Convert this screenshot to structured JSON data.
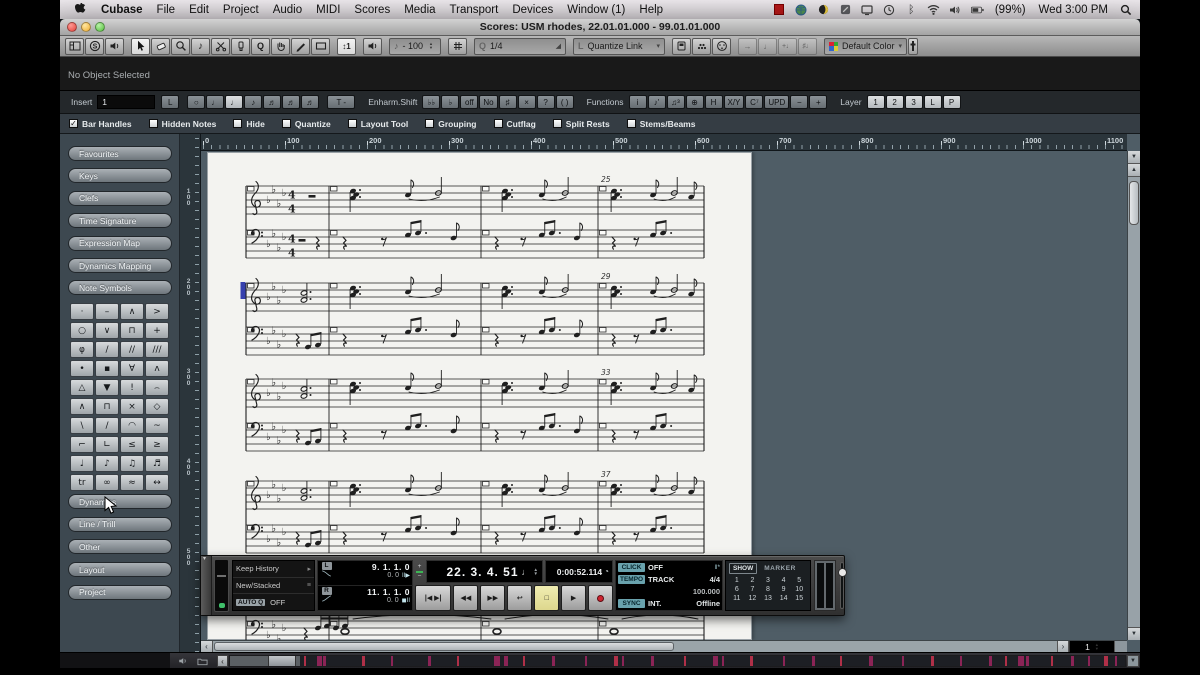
{
  "menubar": {
    "items": [
      "Cubase",
      "File",
      "Edit",
      "Project",
      "Audio",
      "MIDI",
      "Scores",
      "Media",
      "Transport",
      "Devices",
      "Window (1)",
      "Help"
    ],
    "status_icons": [
      "screen-recorder",
      "globe",
      "moon",
      "notes-app",
      "display",
      "time-machine",
      "bluetooth",
      "wifi",
      "volume",
      "battery"
    ],
    "battery": "(99%)",
    "clock": "Wed 3:00 PM"
  },
  "window": {
    "title": "Scores: USM rhodes, 22.01.01.000 - 99.01.01.000"
  },
  "toolbar": {
    "left_icons": [
      "window-layout",
      "solo",
      "acoustic-feedback"
    ],
    "tools": [
      "select",
      "erase",
      "zoom",
      "insert-note",
      "split",
      "glue",
      "quantize",
      "hand",
      "draw",
      "layout"
    ],
    "autoscroll_value": "1",
    "velocity_prefix": "-",
    "velocity_value": "100",
    "quantize_prefix": "Q",
    "quantize_value": "1/4",
    "link_prefix": "L",
    "quantize_link": "Quantize Link",
    "mini_icons": [
      "snap",
      "step-input",
      "midi-input"
    ],
    "disabled_icons": [
      "move-to-cursor",
      "note-length",
      "note-plus",
      "note-up"
    ],
    "color_label": "Default Color"
  },
  "infoline": {
    "text": "No Object Selected"
  },
  "extended": {
    "insert_label": "Insert",
    "insert_value": "1",
    "l_button": "L",
    "note_values": [
      "○",
      "♩",
      "♩",
      "♪",
      "♬",
      "♬",
      "♬"
    ],
    "note_selected_index": 2,
    "tuplet": "T",
    "tuplet_value": "-",
    "enharm_label": "Enharm.Shift",
    "enharm_buttons": [
      "♭♭",
      "♭",
      "off",
      "No",
      "♯",
      "×",
      "?",
      "( )"
    ],
    "functions_label": "Functions",
    "function_buttons": [
      "i",
      "♪'",
      "♫³",
      "⊕",
      "H",
      "X/Y",
      "C⁷",
      "UPD",
      "−",
      "+"
    ],
    "layer_label": "Layer",
    "layer_buttons": [
      "1",
      "2",
      "3",
      "L",
      "P"
    ]
  },
  "filters": [
    {
      "label": "Bar Handles",
      "checked": true
    },
    {
      "label": "Hidden Notes",
      "checked": false
    },
    {
      "label": "Hide",
      "checked": false
    },
    {
      "label": "Quantize",
      "checked": false
    },
    {
      "label": "Layout Tool",
      "checked": false
    },
    {
      "label": "Grouping",
      "checked": false
    },
    {
      "label": "Cutflag",
      "checked": false
    },
    {
      "label": "Split Rests",
      "checked": false
    },
    {
      "label": "Stems/Beams",
      "checked": false
    }
  ],
  "sidebar": {
    "top_buttons": [
      "Favourites",
      "Keys",
      "Clefs",
      "Time Signature",
      "Expression Map",
      "Dynamics Mapping",
      "Note Symbols"
    ],
    "symbols": [
      "·",
      "–",
      "∧",
      ">",
      "○",
      "∨",
      "⊓",
      "+",
      "φ",
      "/",
      "//",
      "///",
      "•",
      "▪",
      "∀",
      "ʌ",
      "△",
      "▼",
      "!",
      "⌢",
      "∧",
      "⊓",
      "×",
      "◇",
      "\\",
      "/",
      "◠",
      "~",
      "⌐",
      "∟",
      "≤",
      "≥",
      "♩",
      "♪",
      "♫",
      "♬",
      "tr",
      "∞",
      "≈",
      "↔"
    ],
    "bottom_buttons": [
      "Dynamics",
      "Line / Trill",
      "Other",
      "Layout",
      "Project"
    ]
  },
  "rulers": {
    "horizontal": [
      "0",
      "100",
      "200",
      "300",
      "400",
      "500",
      "600",
      "700",
      "800",
      "900",
      "1000",
      "1100"
    ],
    "vertical": [
      "100",
      "200",
      "300",
      "400",
      "500"
    ]
  },
  "score": {
    "measure_numbers": [
      "25",
      "29",
      "33",
      "37"
    ],
    "key_signature_flats": 4,
    "time_signature": [
      "4",
      "4"
    ],
    "systems": 5,
    "measures_per_system": 4,
    "clefs": [
      "treble",
      "bass"
    ]
  },
  "transport": {
    "automation_read": "Keep History",
    "automation_write": "New/Stacked",
    "autoq_label": "AUTO Q",
    "autoq_value": "OFF",
    "left_label": "L",
    "right_label": "R",
    "left_locator": "9. 1. 1. 0",
    "left_sub": "0.  0",
    "right_locator": "11. 1. 1. 0",
    "right_sub": "0.  0",
    "position": "22. 3. 4. 51",
    "time": "0:00:52.114",
    "buttons": [
      "locate-prev-next",
      "rewind",
      "forward",
      "cycle",
      "stop",
      "play",
      "record"
    ],
    "click_label": "CLICK",
    "click_value": "OFF",
    "tempo_label": "TEMPO",
    "tempo_value": "TRACK",
    "tempo_sig": "4/4",
    "tempo_bpm": "100.000",
    "sync_label": "SYNC",
    "sync_value": "INT.",
    "sync_status": "Offline",
    "show_label": "SHOW",
    "marker_label": "MARKER",
    "markers": [
      "1",
      "2",
      "3",
      "4",
      "5",
      "6",
      "7",
      "8",
      "9",
      "10",
      "11",
      "12",
      "13",
      "14",
      "15"
    ]
  },
  "scroll": {
    "page_value": "1"
  },
  "overview_marks": [
    [
      0.005,
      2
    ],
    [
      0.02,
      5
    ],
    [
      0.028,
      3
    ],
    [
      0.075,
      3
    ],
    [
      0.11,
      2
    ],
    [
      0.155,
      3
    ],
    [
      0.19,
      2
    ],
    [
      0.235,
      6
    ],
    [
      0.247,
      4
    ],
    [
      0.27,
      2
    ],
    [
      0.305,
      3
    ],
    [
      0.345,
      2
    ],
    [
      0.38,
      4
    ],
    [
      0.39,
      2
    ],
    [
      0.425,
      3
    ],
    [
      0.465,
      2
    ],
    [
      0.5,
      5
    ],
    [
      0.512,
      2
    ],
    [
      0.545,
      3
    ],
    [
      0.585,
      2
    ],
    [
      0.62,
      3
    ],
    [
      0.655,
      2
    ],
    [
      0.69,
      4
    ],
    [
      0.73,
      2
    ],
    [
      0.765,
      3
    ],
    [
      0.8,
      2
    ],
    [
      0.835,
      3
    ],
    [
      0.855,
      2
    ],
    [
      0.87,
      6
    ],
    [
      0.88,
      3
    ],
    [
      0.91,
      2
    ],
    [
      0.935,
      3
    ],
    [
      0.955,
      2
    ],
    [
      0.975,
      4
    ],
    [
      0.988,
      2
    ]
  ],
  "colors": {
    "accent_teal": "#69a2ad",
    "stop_yellow": "#eeeab0",
    "record_red": "#ce2430",
    "mark_purple": "#8b2456",
    "mark_red": "#b03048",
    "page_white": "#f3f3f0",
    "selection_blue": "#3640ad"
  }
}
